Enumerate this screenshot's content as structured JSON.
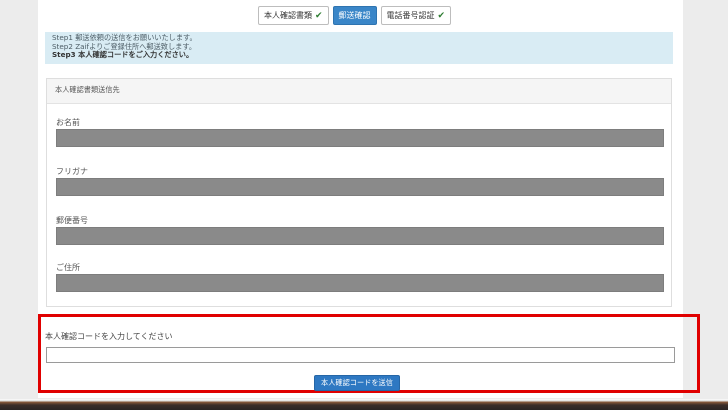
{
  "tabs": [
    {
      "label": "本人確認書類",
      "completed": true
    },
    {
      "label": "郵送確認",
      "completed": false,
      "active": true
    },
    {
      "label": "電話番号認証",
      "completed": true
    }
  ],
  "steps": {
    "step1": "Step1 郵送依頼の送信をお願いいたします。",
    "step2": "Step2 Zaifよりご登録住所へ郵送致します。",
    "step3": "Step3 本人確認コードをご入力ください。"
  },
  "address_card": {
    "title": "本人確認書類送信先",
    "fields": [
      {
        "label": "お名前",
        "value_redacted": true
      },
      {
        "label": "フリガナ",
        "value_redacted": true
      },
      {
        "label": "郵便番号",
        "value_redacted": true
      },
      {
        "label": "ご住所",
        "value_redacted": true
      }
    ]
  },
  "code_entry": {
    "label": "本人確認コードを入力してください",
    "value": "",
    "submit_label": "本人確認コードを送信"
  },
  "colors": {
    "accent": "#3a86c8",
    "info_bg": "#d9ecf4",
    "highlight_border": "#e00000",
    "redaction": "#8a8a8a"
  },
  "icons": {
    "completed": "check-icon"
  }
}
